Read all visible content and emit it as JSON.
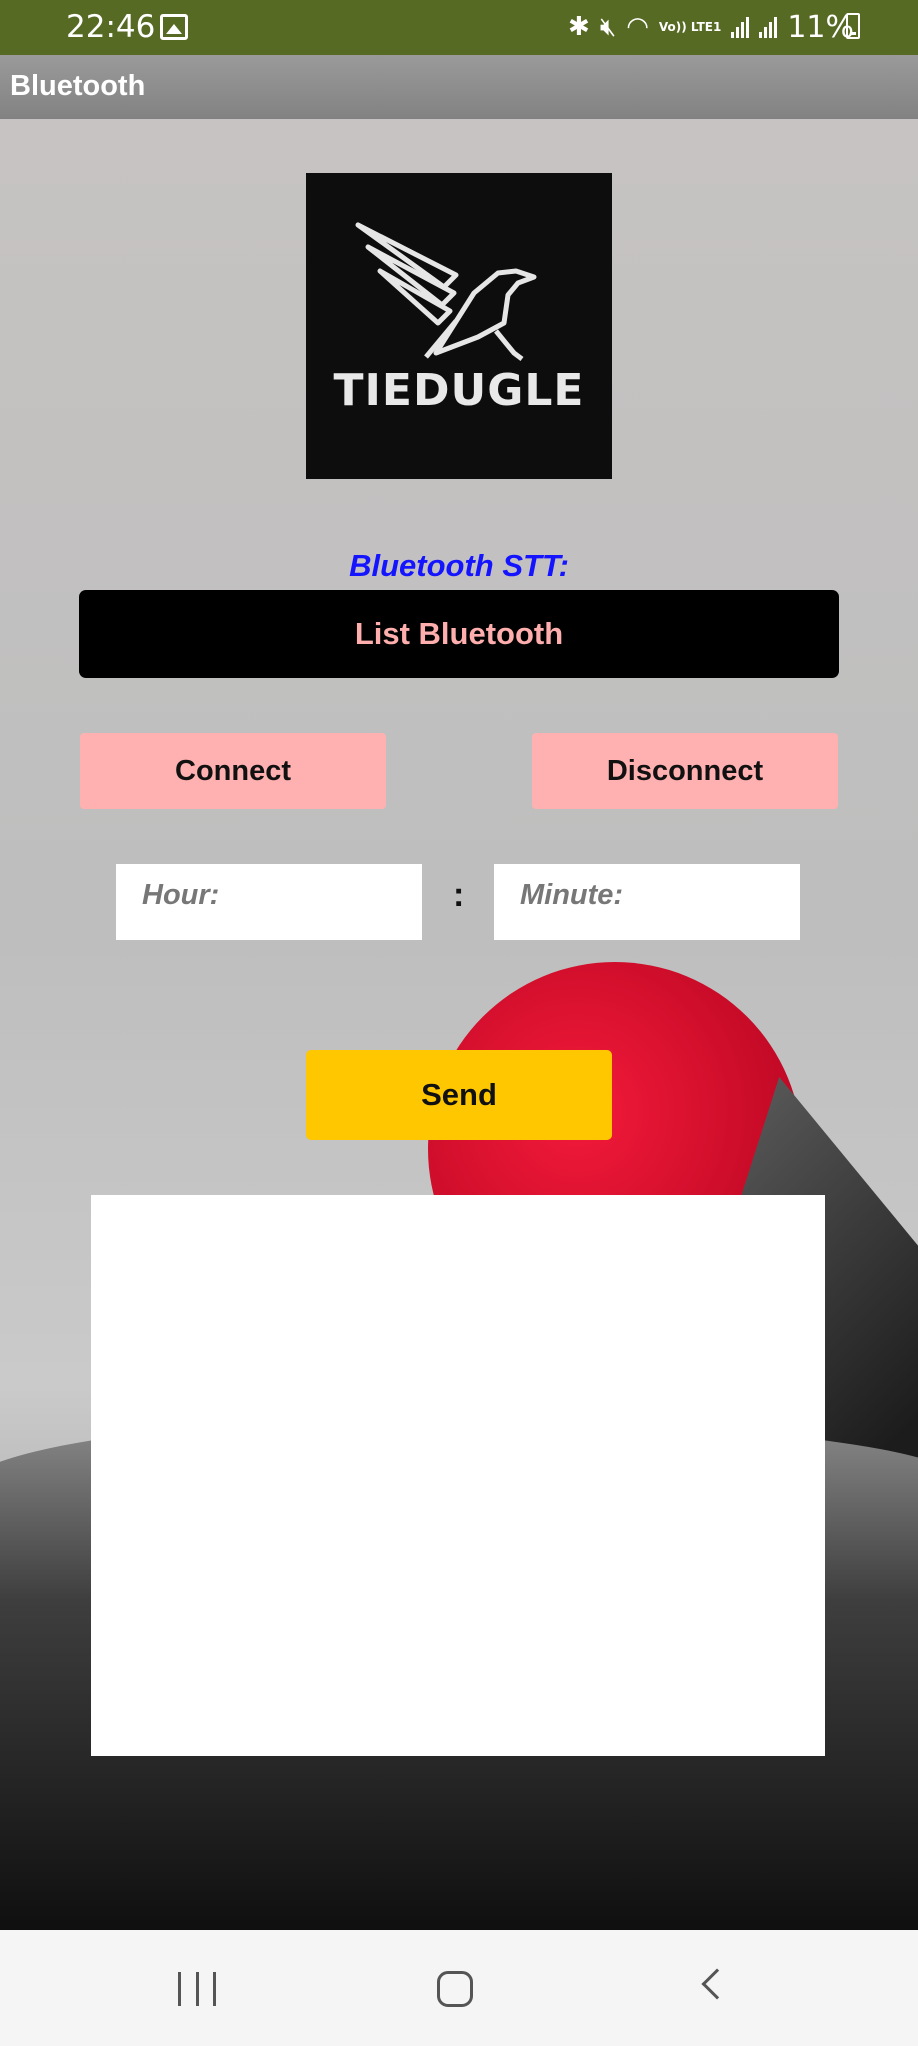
{
  "status_bar": {
    "time": "22:46",
    "network_label": "Vo)) LTE1",
    "battery_percent": "11%",
    "icons": [
      "gallery-icon",
      "bluetooth-icon",
      "mute-icon",
      "wifi-icon",
      "signal-icon",
      "signal-icon",
      "battery-charging-icon"
    ]
  },
  "app_bar": {
    "title": "Bluetooth"
  },
  "logo": {
    "text": "TIEDUGLE",
    "icon": "eagle-icon"
  },
  "bluetooth_label": "Bluetooth STT:",
  "buttons": {
    "list_bluetooth": "List Bluetooth",
    "connect": "Connect",
    "disconnect": "Disconnect",
    "send": "Send"
  },
  "time_inputs": {
    "hour_placeholder": "Hour:",
    "separator": ":",
    "minute_placeholder": "Minute:"
  },
  "colors": {
    "status_bar": "#566a24",
    "label_blue": "#1414ff",
    "list_button_text": "#ffaeae",
    "pink_button": "#ffb0b0",
    "send_button": "#ffc700"
  },
  "nav_bar": {
    "icons": [
      "recents-icon",
      "home-icon",
      "back-icon"
    ]
  }
}
